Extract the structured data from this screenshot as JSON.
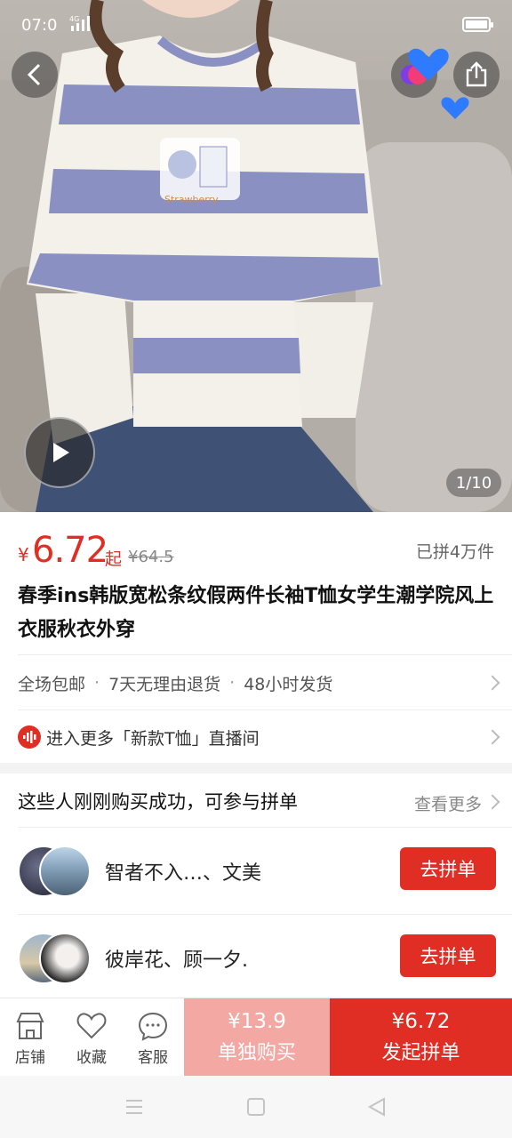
{
  "status_bar": {
    "time": "07:0",
    "network": "4G"
  },
  "gallery": {
    "page_indicator": "1/10"
  },
  "price": {
    "currency": "¥",
    "value": "6.72",
    "suffix": "起",
    "original": "¥64.5",
    "sold": "已拼4万件"
  },
  "product_title": "春季ins韩版宽松条纹假两件长袖T恤女学生潮学院风上衣服秋衣外穿",
  "services": {
    "items": [
      "全场包邮",
      "7天无理由退货",
      "48小时发货"
    ],
    "separator": "·"
  },
  "live": {
    "text": "进入更多「新款T恤」直播间"
  },
  "group_buy": {
    "title": "这些人刚刚购买成功，可参与拼单",
    "see_more": "查看更多",
    "items": [
      {
        "names": "智者不入…、文美",
        "button": "去拼单"
      },
      {
        "names": "彼岸花、顾一夕.",
        "button": "去拼单"
      }
    ]
  },
  "bottom_bar": {
    "store": "店铺",
    "favorite": "收藏",
    "service": "客服",
    "buy_alone_price": "¥13.9",
    "buy_alone_label": "单独购买",
    "buy_group_price": "¥6.72",
    "buy_group_label": "发起拼单"
  },
  "colors": {
    "accent": "#e02e24",
    "accent_light": "#f3a8a3"
  }
}
